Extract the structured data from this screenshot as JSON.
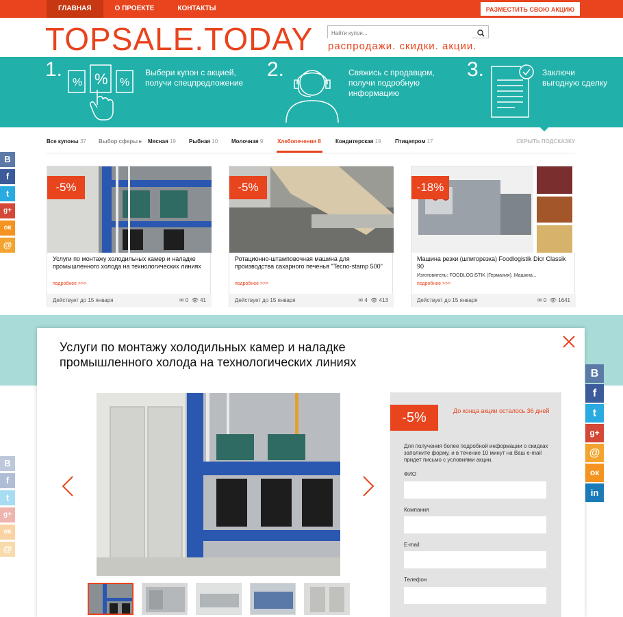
{
  "nav": {
    "items": [
      "ГЛАВНАЯ",
      "О ПРОЕКТЕ",
      "КОНТАКТЫ"
    ],
    "place_button": "РАЗМЕСТИТЬ СВОЮ АКЦИЮ"
  },
  "logo": "TOPSALE.TODAY",
  "search": {
    "placeholder": "Найти купон..."
  },
  "tagline": "распродажи. скидки. акции.",
  "steps": [
    {
      "num": "1.",
      "text": "Выбери купон с акцией, получи спецпредложение"
    },
    {
      "num": "2.",
      "text": "Свяжись с продавцом, получи подробную информацию"
    },
    {
      "num": "3.",
      "text": "Заключи выгодную сделку"
    }
  ],
  "filters": {
    "items": [
      {
        "label": "Все купоны",
        "count": "37"
      },
      {
        "label": "Выбор сферы ▸",
        "count": ""
      },
      {
        "label": "Мясная",
        "count": "19"
      },
      {
        "label": "Рыбная",
        "count": "10"
      },
      {
        "label": "Молочная",
        "count": "9"
      },
      {
        "label": "Хлебопечения",
        "count": "8"
      },
      {
        "label": "Кондитерская",
        "count": "19"
      },
      {
        "label": "Птицепром",
        "count": "17"
      }
    ],
    "hide_hint": "СКРЫТЬ ПОДСКАЗКУ"
  },
  "cards": [
    {
      "discount": "-5%",
      "title": "Услуги по монтажу холодильных камер и наладке промышленного холода на технологических линиях",
      "more": "подробнее >>>",
      "valid": "Действует до 15 января",
      "mails": "0",
      "views": "41"
    },
    {
      "discount": "-5%",
      "title": "Ротационно-штамповочная машина для производства сахарного печенья \"Tecno-stamp 500\"",
      "more": "подробнее >>>",
      "valid": "Действует до 15 января",
      "mails": "4",
      "views": "413"
    },
    {
      "discount": "-18%",
      "title": "Машина резки (шпигорезка) Foodlogistik Dicr Classik 90",
      "subtitle": "Изготовитель: FOODLOGISTIK (Германия). Машина...",
      "more": "подробнее >>>",
      "valid": "Действует до 15 января",
      "mails": "0",
      "views": "1641"
    }
  ],
  "modal": {
    "title": "Услуги по монтажу холодильных камер и наладке промышленного холода на технологических линиях",
    "discount": "-5%",
    "time_left": "До конца акции осталось 36 дней",
    "info": "Для получения более подробной информации о скидках заполните форму, и в течение 10 минут на Ваш e-mail придет письмо с условиями акции.",
    "fields": [
      "ФИО",
      "Компания",
      "E-mail",
      "Телефон"
    ]
  },
  "share_left": [
    "В",
    "f",
    "t",
    "g+",
    "ок",
    "@"
  ],
  "share_right": [
    "В",
    "f",
    "t",
    "g+",
    "@",
    "ок",
    "in"
  ],
  "colors": {
    "accent": "#e8441e",
    "teal": "#21b0aa"
  }
}
